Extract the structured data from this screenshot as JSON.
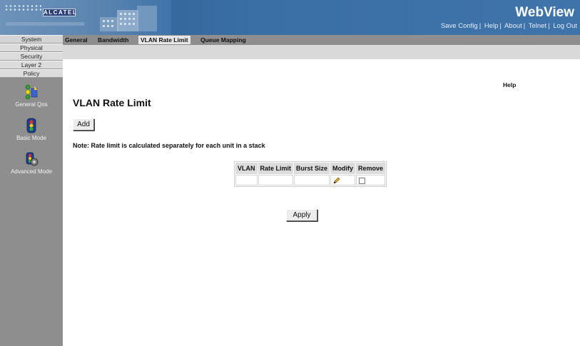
{
  "header": {
    "logo_text": "ALCATEL",
    "brand": "WebView",
    "links": [
      "Save Config",
      "Help",
      "About",
      "Telnet",
      "Log Out"
    ]
  },
  "leftnav": {
    "buttons": [
      "System",
      "Physical",
      "Security",
      "Layer 2",
      "Policy"
    ],
    "tools": [
      {
        "label": "General Qos",
        "icon": "general-qos-icon"
      },
      {
        "label": "Basic Mode",
        "icon": "traffic-light-icon"
      },
      {
        "label": "Advanced Mode",
        "icon": "advanced-mode-icon"
      }
    ]
  },
  "tabs": [
    "General",
    "Bandwidth",
    "VLAN Rate Limit",
    "Queue Mapping"
  ],
  "active_tab": "VLAN Rate Limit",
  "main": {
    "help": "Help",
    "title": "VLAN Rate Limit",
    "add_label": "Add",
    "note": "Note: Rate limit is calculated separately for each unit in a stack",
    "table": {
      "headers": [
        "VLAN",
        "Rate Limit",
        "Burst Size",
        "Modify",
        "Remove"
      ],
      "rows": [
        {
          "vlan": "",
          "rate_limit": "",
          "burst_size": "",
          "modify_icon": "pencil-icon",
          "remove": false
        }
      ]
    },
    "apply_label": "Apply"
  },
  "colors": {
    "header_blue": "#3a6fa5",
    "nav_gray": "#8e8e8e",
    "button_gray": "#dcdcdc"
  }
}
